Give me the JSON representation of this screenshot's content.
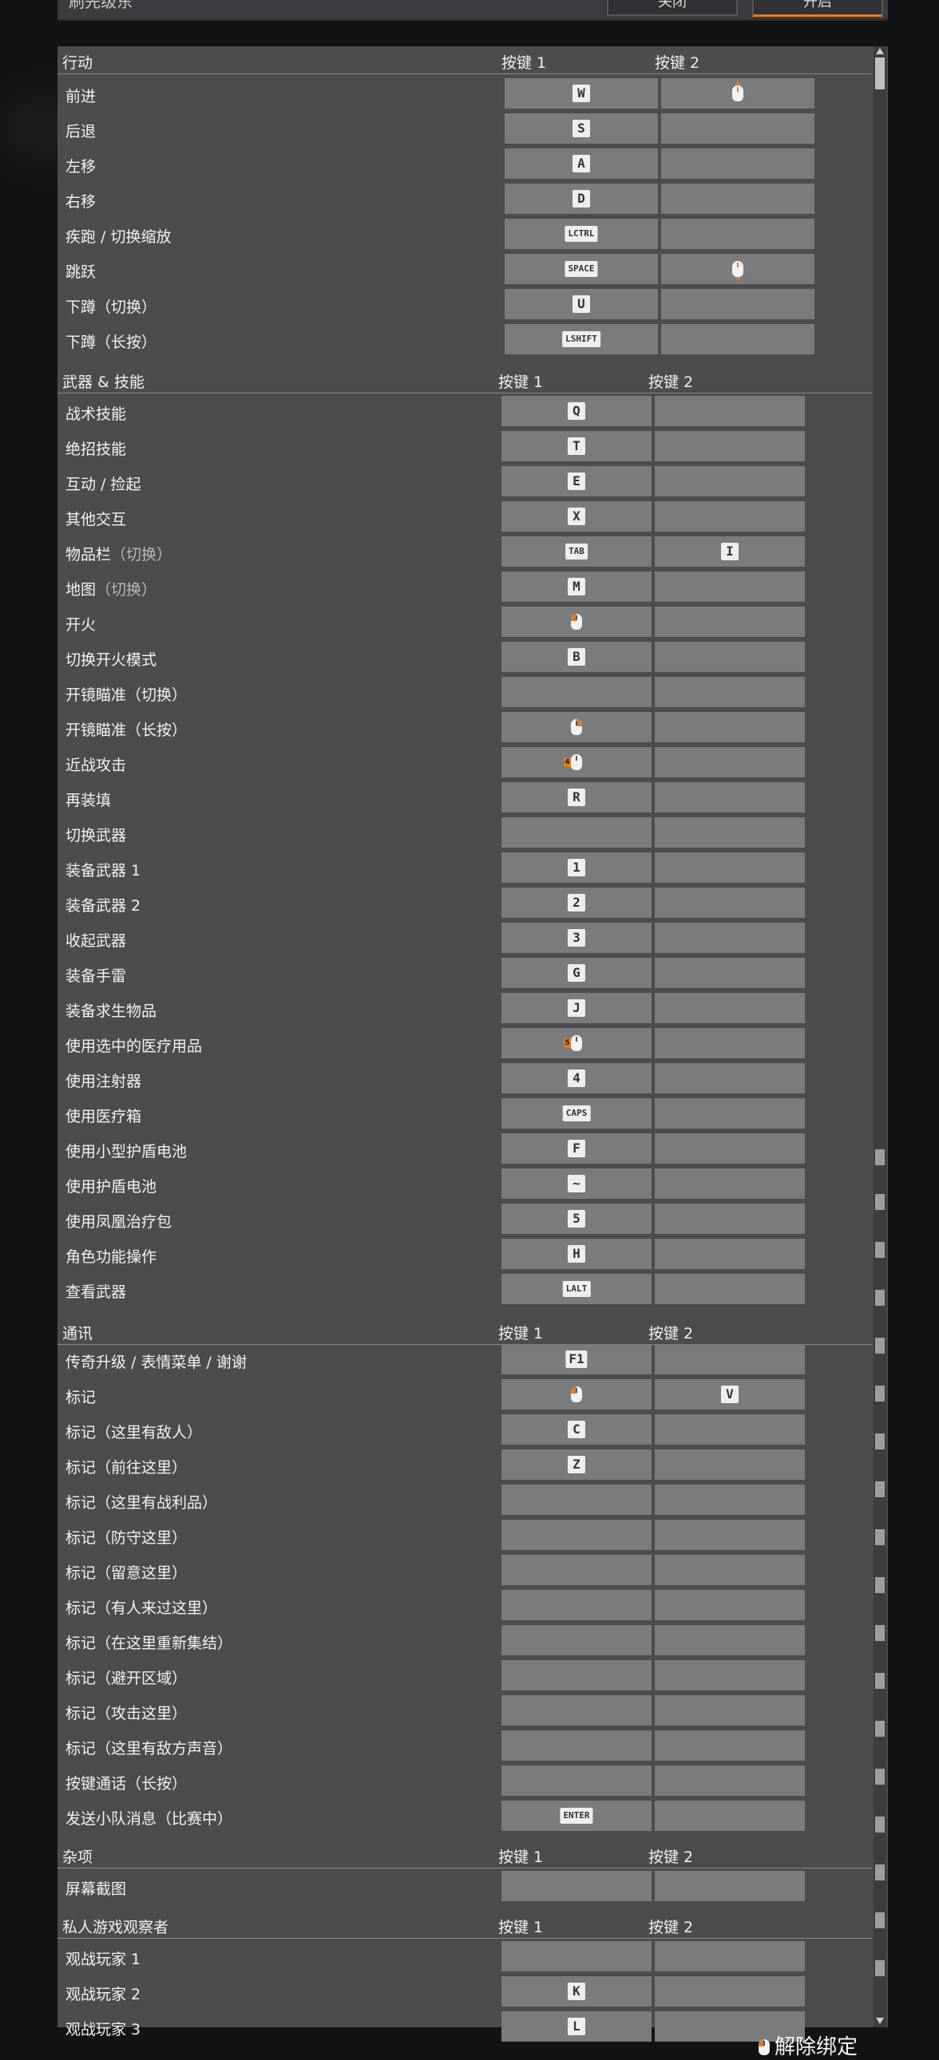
{
  "header": {
    "settings_label": "刷先级东",
    "button_off": "关闭",
    "button_on": "开启"
  },
  "columns": {
    "key1": "按键 1",
    "key2": "按键 2"
  },
  "sections": [
    {
      "title": "行动",
      "rows": [
        {
          "label": "前进",
          "k1": "W",
          "k2": "wheel-up"
        },
        {
          "label": "后退",
          "k1": "S",
          "k2": ""
        },
        {
          "label": "左移",
          "k1": "A",
          "k2": ""
        },
        {
          "label": "右移",
          "k1": "D",
          "k2": ""
        },
        {
          "label": "疾跑 / 切换缩放",
          "k1": "LCTRL",
          "k2": ""
        },
        {
          "label": "跳跃",
          "k1": "SPACE",
          "k2": "wheel-down"
        },
        {
          "label": "下蹲（切换）",
          "k1": "U",
          "k2": ""
        },
        {
          "label": "下蹲（长按）",
          "k1": "LSHIFT",
          "k2": ""
        }
      ]
    },
    {
      "title": "武器 & 技能",
      "rows": [
        {
          "label": "战术技能",
          "k1": "Q",
          "k2": ""
        },
        {
          "label": "绝招技能",
          "k1": "T",
          "k2": ""
        },
        {
          "label": "互动 / 捡起",
          "k1": "E",
          "k2": ""
        },
        {
          "label": "其他交互",
          "k1": "X",
          "k2": ""
        },
        {
          "label": "物品栏",
          "sub": "（切换）",
          "k1": "TAB",
          "k2": "I"
        },
        {
          "label": "地图",
          "sub": "（切换）",
          "k1": "M",
          "k2": ""
        },
        {
          "label": "开火",
          "k1": "mouse-left",
          "k2": ""
        },
        {
          "label": "切换开火模式",
          "k1": "B",
          "k2": ""
        },
        {
          "label": "开镜瞄准（切换）",
          "k1": "",
          "k2": ""
        },
        {
          "label": "开镜瞄准（长按）",
          "k1": "mouse-right",
          "k2": ""
        },
        {
          "label": "近战攻击",
          "k1": "mouse-4",
          "k2": ""
        },
        {
          "label": "再装填",
          "k1": "R",
          "k2": ""
        },
        {
          "label": "切换武器",
          "k1": "",
          "k2": ""
        },
        {
          "label": "装备武器 1",
          "k1": "1",
          "k2": ""
        },
        {
          "label": "装备武器 2",
          "k1": "2",
          "k2": ""
        },
        {
          "label": "收起武器",
          "k1": "3",
          "k2": ""
        },
        {
          "label": "装备手雷",
          "k1": "G",
          "k2": ""
        },
        {
          "label": "装备求生物品",
          "k1": "J",
          "k2": ""
        },
        {
          "label": "使用选中的医疗用品",
          "k1": "mouse-5",
          "k2": ""
        },
        {
          "label": "使用注射器",
          "k1": "4",
          "k2": ""
        },
        {
          "label": "使用医疗箱",
          "k1": "CAPS",
          "k2": ""
        },
        {
          "label": "使用小型护盾电池",
          "k1": "F",
          "k2": ""
        },
        {
          "label": "使用护盾电池",
          "k1": "~",
          "k2": ""
        },
        {
          "label": "使用凤凰治疗包",
          "k1": "5",
          "k2": ""
        },
        {
          "label": "角色功能操作",
          "k1": "H",
          "k2": ""
        },
        {
          "label": "查看武器",
          "k1": "LALT",
          "k2": ""
        }
      ]
    },
    {
      "title": "通讯",
      "rows": [
        {
          "label": "传奇升级 / 表情菜单 / 谢谢",
          "k1": "F1",
          "k2": ""
        },
        {
          "label": "标记",
          "k1": "mouse-middle",
          "k2": "V"
        },
        {
          "label": "标记（这里有敌人）",
          "k1": "C",
          "k2": ""
        },
        {
          "label": "标记（前往这里）",
          "k1": "Z",
          "k2": ""
        },
        {
          "label": "标记（这里有战利品）",
          "k1": "",
          "k2": ""
        },
        {
          "label": "标记（防守这里）",
          "k1": "",
          "k2": ""
        },
        {
          "label": "标记（留意这里）",
          "k1": "",
          "k2": ""
        },
        {
          "label": "标记（有人来过这里）",
          "k1": "",
          "k2": ""
        },
        {
          "label": "标记（在这里重新集结）",
          "k1": "",
          "k2": ""
        },
        {
          "label": "标记（避开区域）",
          "k1": "",
          "k2": ""
        },
        {
          "label": "标记（攻击这里）",
          "k1": "",
          "k2": ""
        },
        {
          "label": "标记（这里有敌方声音）",
          "k1": "",
          "k2": ""
        },
        {
          "label": "按键通话（长按）",
          "k1": "",
          "k2": ""
        },
        {
          "label": "发送小队消息（比赛中）",
          "k1": "ENTER",
          "k2": ""
        }
      ]
    },
    {
      "title": "杂项",
      "rows": [
        {
          "label": "屏幕截图",
          "k1": "",
          "k2": ""
        }
      ]
    },
    {
      "title": "私人游戏观察者",
      "rows": [
        {
          "label": "观战玩家 1",
          "k1": "",
          "k2": ""
        },
        {
          "label": "观战玩家 2",
          "k1": "K",
          "k2": ""
        },
        {
          "label": "观战玩家 3",
          "k1": "L",
          "k2": ""
        }
      ]
    }
  ],
  "footer": {
    "unbind_label": "解除绑定"
  },
  "colors": {
    "accent": "#e07b26",
    "panel": "#4b4c4e",
    "cell": "#7a7b7d"
  }
}
